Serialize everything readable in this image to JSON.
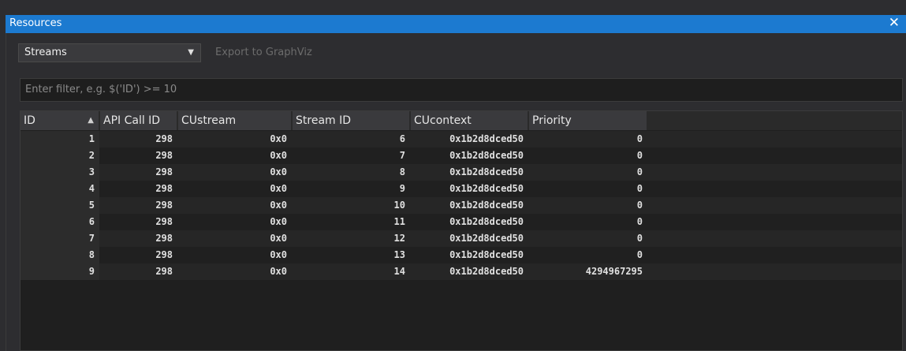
{
  "window": {
    "title": "Resources",
    "close_glyph": "✕"
  },
  "toolbar": {
    "type_select": "Streams",
    "export_label": "Export to GraphViz"
  },
  "filter": {
    "placeholder": "Enter filter, e.g. $('ID') >= 10"
  },
  "table": {
    "columns": [
      "ID",
      "API Call ID",
      "CUstream",
      "Stream ID",
      "CUcontext",
      "Priority"
    ],
    "sort_column": "ID",
    "sort_direction": "ascending",
    "rows": [
      [
        "1",
        "298",
        "0x0",
        "6",
        "0x1b2d8dced50",
        "0"
      ],
      [
        "2",
        "298",
        "0x0",
        "7",
        "0x1b2d8dced50",
        "0"
      ],
      [
        "3",
        "298",
        "0x0",
        "8",
        "0x1b2d8dced50",
        "0"
      ],
      [
        "4",
        "298",
        "0x0",
        "9",
        "0x1b2d8dced50",
        "0"
      ],
      [
        "5",
        "298",
        "0x0",
        "10",
        "0x1b2d8dced50",
        "0"
      ],
      [
        "6",
        "298",
        "0x0",
        "11",
        "0x1b2d8dced50",
        "0"
      ],
      [
        "7",
        "298",
        "0x0",
        "12",
        "0x1b2d8dced50",
        "0"
      ],
      [
        "8",
        "298",
        "0x0",
        "13",
        "0x1b2d8dced50",
        "0"
      ],
      [
        "9",
        "298",
        "0x0",
        "14",
        "0x1b2d8dced50",
        "4294967295"
      ]
    ]
  },
  "colors": {
    "title_bar": "#1c7ad0",
    "background": "#2d2d30",
    "table_background": "#1f1f1f"
  }
}
